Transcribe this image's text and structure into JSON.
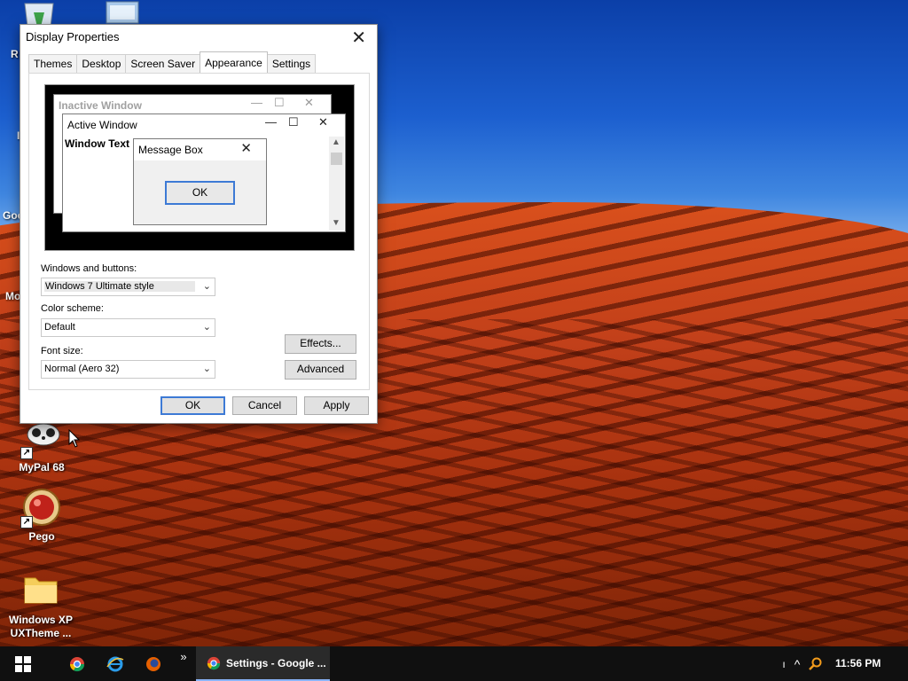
{
  "desktop": {
    "icons": [
      {
        "label": "MyPal 68"
      },
      {
        "label": "Pego"
      },
      {
        "label": "Windows XP UXTheme ..."
      }
    ],
    "partial_labels": [
      "R",
      "I",
      "Goo",
      "Mo"
    ]
  },
  "dialog": {
    "title": "Display Properties",
    "tabs": [
      "Themes",
      "Desktop",
      "Screen Saver",
      "Appearance",
      "Settings"
    ],
    "active_tab": "Appearance",
    "preview": {
      "inactive_title": "Inactive Window",
      "active_title": "Active Window",
      "window_text": "Window Text",
      "message_box_title": "Message Box",
      "message_ok": "OK"
    },
    "windows_buttons_label": "Windows and buttons:",
    "windows_buttons_value": "Windows 7 Ultimate style",
    "color_scheme_label": "Color scheme:",
    "color_scheme_value": "Default",
    "font_size_label": "Font size:",
    "font_size_value": "Normal (Aero 32)",
    "effects_button": "Effects...",
    "advanced_button": "Advanced",
    "ok_button": "OK",
    "cancel_button": "Cancel",
    "apply_button": "Apply"
  },
  "taskbar": {
    "active_app": "Settings - Google ...",
    "overflow": "»",
    "clock": "11:56 PM",
    "tray_text": "ı"
  },
  "colors": {
    "accent": "#3d7ad5",
    "taskbar": "#101010"
  }
}
